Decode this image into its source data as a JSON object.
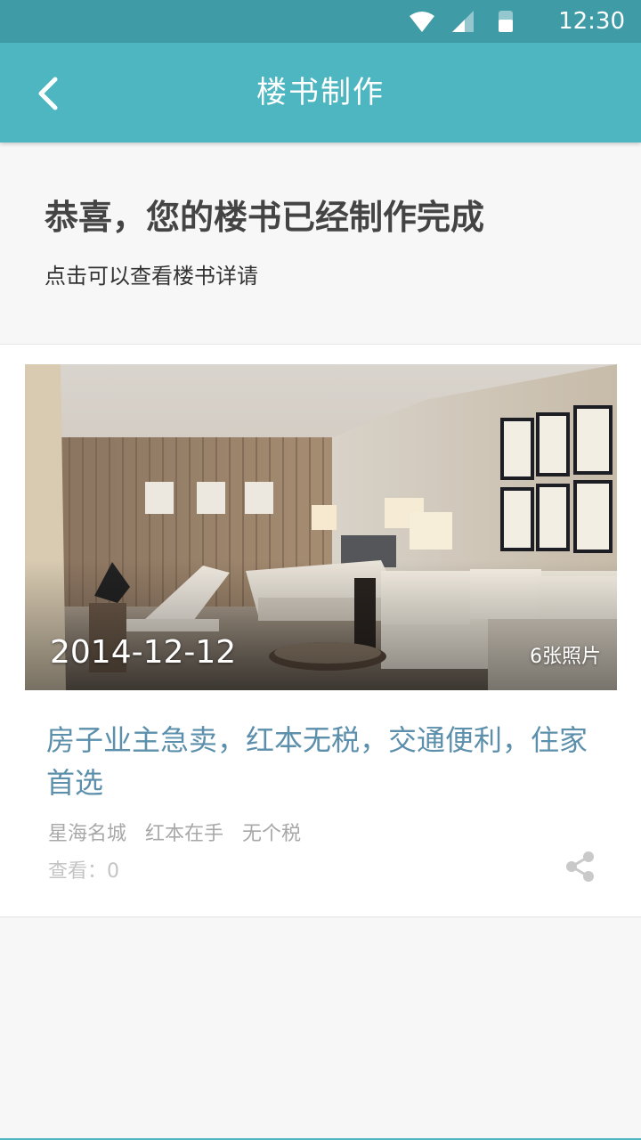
{
  "status_bar": {
    "time": "12:30"
  },
  "app_bar": {
    "title": "楼书制作"
  },
  "intro": {
    "headline": "恭喜，您的楼书已经制作完成",
    "subtext": "点击可以查看楼书详请"
  },
  "listing": {
    "date": "2014-12-12",
    "photo_count": "6张照片",
    "title": "房子业主急卖，红本无税，交通便利，住家首选",
    "tags": [
      "星海名城",
      "红本在手",
      "无个税"
    ],
    "views_label": "查看：",
    "views_value": "0"
  },
  "colors": {
    "accent": "#4db6c1",
    "status": "#3f9ba6",
    "link": "#5b8fab"
  }
}
